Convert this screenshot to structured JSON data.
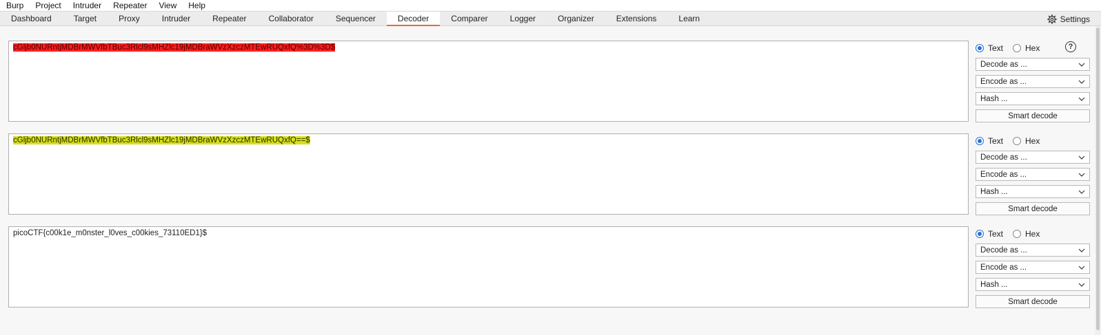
{
  "menu": [
    "Burp",
    "Project",
    "Intruder",
    "Repeater",
    "View",
    "Help"
  ],
  "tabs": [
    "Dashboard",
    "Target",
    "Proxy",
    "Intruder",
    "Repeater",
    "Collaborator",
    "Sequencer",
    "Decoder",
    "Comparer",
    "Logger",
    "Organizer",
    "Extensions",
    "Learn"
  ],
  "active_tab": "Decoder",
  "settings_label": "Settings",
  "help_glyph": "?",
  "colors": {
    "accent": "#e8692c",
    "highlight_red": "#ff1f1f",
    "highlight_yellow": "#d6e01a",
    "radio_blue": "#2a6fd6"
  },
  "panels": [
    {
      "content": "cGljb0NURntjMDBrMWVfbTBuc3Rlcl9sMHZlc19jMDBraWVzXzczMTEwRUQxfQ%3D%3D$",
      "highlight": "red",
      "text_label": "Text",
      "hex_label": "Hex",
      "mode": "Text",
      "decode_label": "Decode as ...",
      "encode_label": "Encode as ...",
      "hash_label": "Hash ...",
      "smart_label": "Smart decode"
    },
    {
      "content": "cGljb0NURntjMDBrMWVfbTBuc3Rlcl9sMHZlc19jMDBraWVzXzczMTEwRUQxfQ==$",
      "highlight": "yellow",
      "text_label": "Text",
      "hex_label": "Hex",
      "mode": "Text",
      "decode_label": "Decode as ...",
      "encode_label": "Encode as ...",
      "hash_label": "Hash ...",
      "smart_label": "Smart decode"
    },
    {
      "content": "picoCTF{c00k1e_m0nster_l0ves_c00kies_73110ED1}$",
      "highlight": "none",
      "text_label": "Text",
      "hex_label": "Hex",
      "mode": "Text",
      "decode_label": "Decode as ...",
      "encode_label": "Encode as ...",
      "hash_label": "Hash ...",
      "smart_label": "Smart decode"
    }
  ]
}
